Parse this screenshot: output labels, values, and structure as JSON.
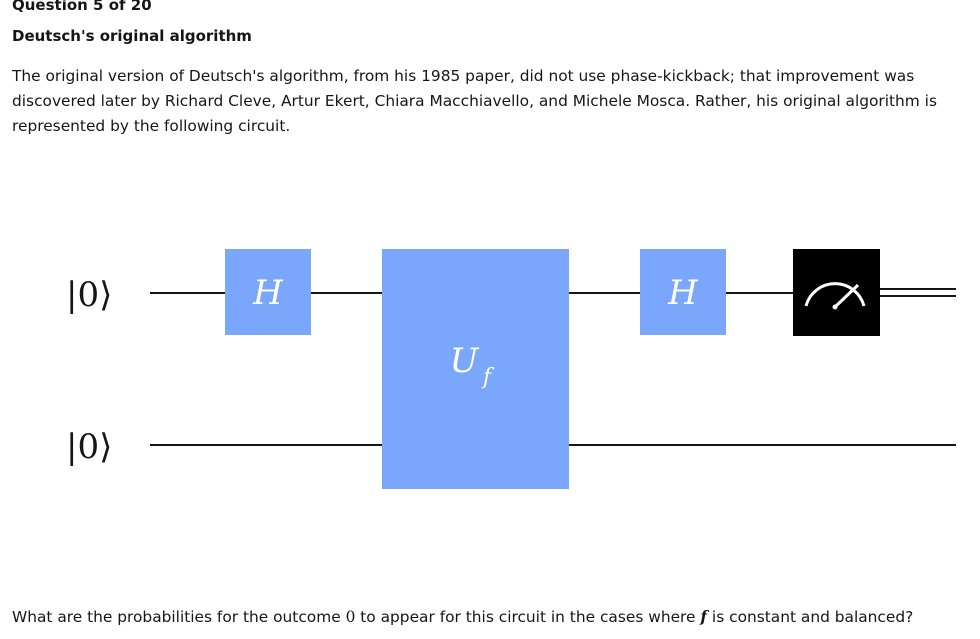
{
  "header": {
    "question_number": "Question 5 of 20",
    "title": "Deutsch's original algorithm"
  },
  "intro": {
    "lines": [
      "The original version of Deutsch's algorithm, from his 1985 paper, did not use phase-kickback; that improvement was",
      "discovered later by Richard Cleve, Artur Ekert, Chiara Macchiavello, and Michele Mosca. Rather, his original algorithm is",
      "represented by the following circuit."
    ]
  },
  "circuit": {
    "qubits": [
      {
        "label": "|0⟩"
      },
      {
        "label": "|0⟩"
      }
    ],
    "gates": {
      "hadamard_1": "H",
      "oracle_main": "U",
      "oracle_sub": "f",
      "hadamard_2": "H"
    },
    "colors": {
      "gate": "#7aa7fb",
      "measure_bg": "#000000",
      "measure_fg": "#ffffff",
      "wire": "#161616"
    },
    "measure_icon": "gauge-meter-icon"
  },
  "question": {
    "part1": "What are the probabilities for the outcome ",
    "outcome": "0",
    "part2": " to appear for this circuit in the cases where ",
    "function": "f",
    "part3": " is constant and balanced?"
  }
}
